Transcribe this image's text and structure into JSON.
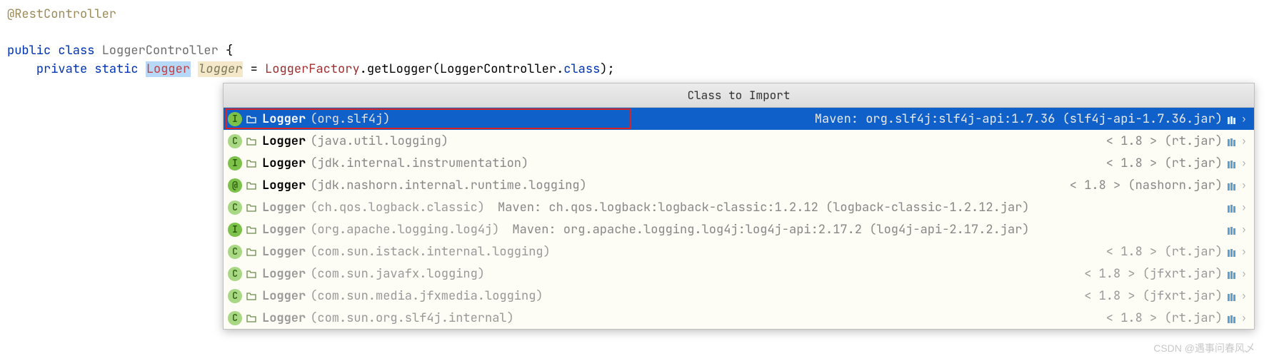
{
  "code": {
    "annotation": "@RestController",
    "kw_public": "public",
    "kw_class": "class",
    "class_name": "LoggerController",
    "brace_open": "{",
    "kw_private": "private",
    "kw_static": "static",
    "type_logger": "Logger",
    "field_name": "logger",
    "equals": " = ",
    "factory": "LoggerFactory",
    "dot1": ".",
    "method": "getLogger",
    "paren_open": "(",
    "arg_class": "LoggerController",
    "dot2": ".",
    "kw_class2": "class",
    "paren_close_semi": ");"
  },
  "popup": {
    "header": "Class to Import",
    "items": [
      {
        "icon": "I",
        "class": "Logger",
        "pkg": "(org.slf4j)",
        "mid": "",
        "right": "Maven: org.slf4j:slf4j-api:1.7.36 (slf4j-api-1.7.36.jar)",
        "selected": true,
        "dimmed": false,
        "red": true
      },
      {
        "icon": "C",
        "class": "Logger",
        "pkg": "(java.util.logging)",
        "mid": "",
        "right": "< 1.8 > (rt.jar)",
        "selected": false,
        "dimmed": false,
        "red": false
      },
      {
        "icon": "I",
        "class": "Logger",
        "pkg": "(jdk.internal.instrumentation)",
        "mid": "",
        "right": "< 1.8 > (rt.jar)",
        "selected": false,
        "dimmed": false,
        "red": false
      },
      {
        "icon": "@",
        "class": "Logger",
        "pkg": "(jdk.nashorn.internal.runtime.logging)",
        "mid": "",
        "right": "< 1.8 > (nashorn.jar)",
        "selected": false,
        "dimmed": false,
        "red": false
      },
      {
        "icon": "C",
        "class": "Logger",
        "pkg": "(ch.qos.logback.classic)",
        "mid": "Maven: ch.qos.logback:logback-classic:1.2.12 (logback-classic-1.2.12.jar)",
        "right": "",
        "selected": false,
        "dimmed": true,
        "red": false
      },
      {
        "icon": "I",
        "class": "Logger",
        "pkg": "(org.apache.logging.log4j)",
        "mid": "Maven: org.apache.logging.log4j:log4j-api:2.17.2 (log4j-api-2.17.2.jar)",
        "right": "",
        "selected": false,
        "dimmed": true,
        "red": false
      },
      {
        "icon": "C",
        "class": "Logger",
        "pkg": "(com.sun.istack.internal.logging)",
        "mid": "",
        "right": "< 1.8 > (rt.jar)",
        "selected": false,
        "dimmed": true,
        "red": false
      },
      {
        "icon": "C",
        "class": "Logger",
        "pkg": "(com.sun.javafx.logging)",
        "mid": "",
        "right": "< 1.8 > (jfxrt.jar)",
        "selected": false,
        "dimmed": true,
        "red": false
      },
      {
        "icon": "C",
        "class": "Logger",
        "pkg": "(com.sun.media.jfxmedia.logging)",
        "mid": "",
        "right": "< 1.8 > (jfxrt.jar)",
        "selected": false,
        "dimmed": true,
        "red": false
      },
      {
        "icon": "C",
        "class": "Logger",
        "pkg": "(com.sun.org.slf4j.internal)",
        "mid": "",
        "right": "< 1.8 > (rt.jar)",
        "selected": false,
        "dimmed": true,
        "red": false
      }
    ]
  },
  "watermark": "CSDN @遇事问春风乄"
}
